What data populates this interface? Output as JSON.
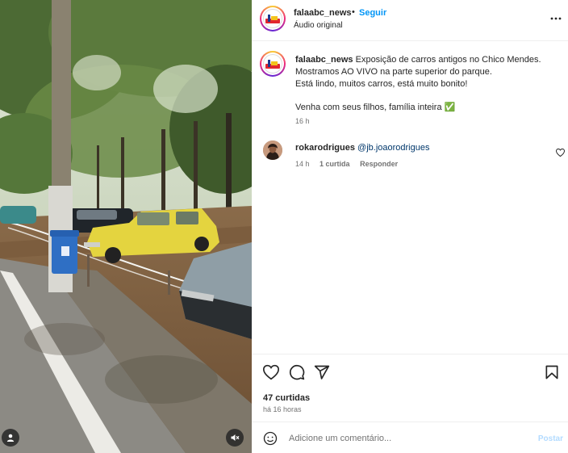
{
  "post": {
    "username": "falaabc_news",
    "separator": "•",
    "follow_label": "Seguir",
    "audio_label": "Áudio original"
  },
  "caption": {
    "username": "falaabc_news",
    "lines": [
      "Exposição de carros antigos no Chico Mendes.",
      "Mostramos AO VIVO na parte superior do parque.",
      "Está lindo, muitos carros, está muito bonito!",
      "",
      "Venha com seus filhos, família inteira ✅"
    ],
    "time": "16 h"
  },
  "comments": [
    {
      "username": "rokarodrigues",
      "mention": "@jb.joaorodrigues",
      "time": "14 h",
      "likes": "1 curtida",
      "reply_label": "Responder"
    }
  ],
  "actions": {
    "likes_label": "47 curtidas",
    "time_ago": "há 16 horas"
  },
  "composer": {
    "placeholder": "Adicione um comentário...",
    "post_label": "Postar"
  },
  "icons": {
    "more": "more-horizontal-icon",
    "like": "heart-icon",
    "comment": "comment-bubble-icon",
    "share": "paper-plane-icon",
    "save": "bookmark-icon",
    "emoji": "smiley-icon",
    "user_tag": "person-icon",
    "mute": "speaker-muted-icon"
  },
  "colors": {
    "accent": "#0095f6",
    "text": "#262626",
    "secondary": "#737373",
    "post_disabled": "#b3dbff"
  }
}
